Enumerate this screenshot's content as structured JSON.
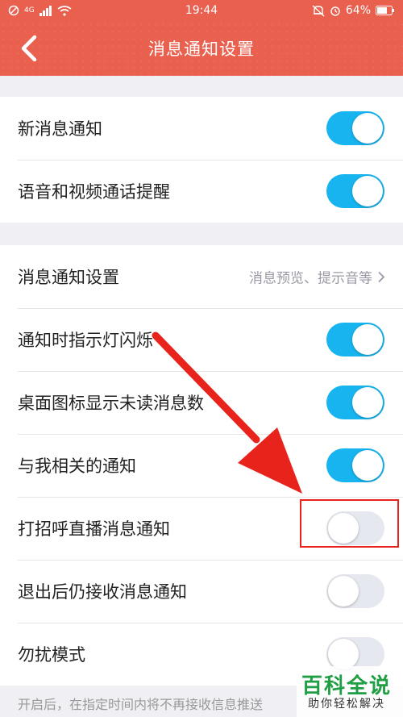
{
  "status_bar": {
    "time": "19:44",
    "signal_label": "4G",
    "battery": "64%",
    "icons": [
      "no-disturb-icon",
      "signal-icon",
      "wifi-icon",
      "alarm-icon",
      "mute-icon",
      "battery-icon"
    ]
  },
  "nav": {
    "title": "消息通知设置",
    "back_icon": "chevron-left-icon"
  },
  "group1": {
    "items": [
      {
        "label": "新消息通知",
        "state": "on"
      },
      {
        "label": "语音和视频通话提醒",
        "state": "on"
      }
    ]
  },
  "group2": {
    "settings_row": {
      "label": "消息通知设置",
      "value": "消息预览、提示音等"
    },
    "items": [
      {
        "label": "通知时指示灯闪烁",
        "state": "on"
      },
      {
        "label": "桌面图标显示未读消息数",
        "state": "on"
      },
      {
        "label": "与我相关的通知",
        "state": "on"
      },
      {
        "label": "打招呼直播消息通知",
        "state": "off"
      },
      {
        "label": "退出后仍接收消息通知",
        "state": "off"
      },
      {
        "label": "勿扰模式",
        "state": "off"
      }
    ]
  },
  "footnote": "开启后，在指定时间内将不再接收信息推送",
  "watermark": {
    "title": "百科全说",
    "subtitle": "助你轻松解决"
  },
  "colors": {
    "accent": "#e9604f",
    "toggle_on": "#18b4ef",
    "toggle_off": "#e6e8f0",
    "annotation": "#e8231c"
  }
}
